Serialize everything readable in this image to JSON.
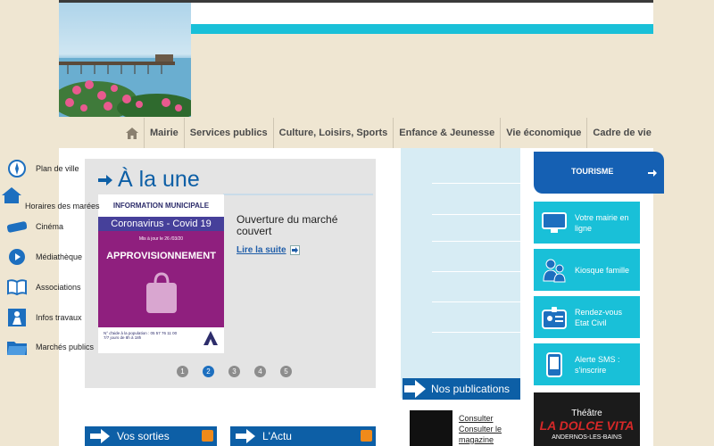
{
  "nav": {
    "items": [
      "Mairie",
      "Services publics",
      "Culture, Loisirs, Sports",
      "Enfance & Jeunesse",
      "Vie économique",
      "Cadre de vie"
    ]
  },
  "une": {
    "title": "À la une",
    "news_title": "Ouverture du marché couvert",
    "read_more": "Lire la suite",
    "poster": {
      "header": "INFORMATION MUNICIPALE",
      "band": "Coronavirus - Covid 19",
      "date": "Mis à jour le 26 /03/20",
      "headline": "APPROVISIONNEMENT",
      "footer_line1": "N° d'aide à la population : 05 57 76 11 00",
      "footer_line2": "7/7 jours de 8h à 18h"
    },
    "pages": [
      "1",
      "2",
      "3",
      "4",
      "5"
    ],
    "active_page": "2"
  },
  "quick_links": [
    "Plan de ville",
    "Horaires des marées",
    "Cinéma",
    "Médiathèque",
    "Associations",
    "Infos travaux",
    "Marchés publics"
  ],
  "publications": {
    "title": "Nos publications",
    "magazine_link": "Consulter Consulter le magazine"
  },
  "right": {
    "tourisme": "TOURISME",
    "boxes": [
      "Votre mairie en ligne",
      "Kiosque famille",
      "Rendez-vous Etat Civil",
      "Alerte SMS : s'inscrire"
    ],
    "theatre": {
      "line1": "Théâtre",
      "line2": "LA DOLCE VITA",
      "line3": "ANDERNOS-LES-BAINS"
    }
  },
  "bottom": {
    "sorties": "Vos sorties",
    "actu": "L'Actu"
  },
  "colors": {
    "accent_blue": "#0d5fa6",
    "cyan": "#19c0d8",
    "background": "#efe6d2"
  }
}
